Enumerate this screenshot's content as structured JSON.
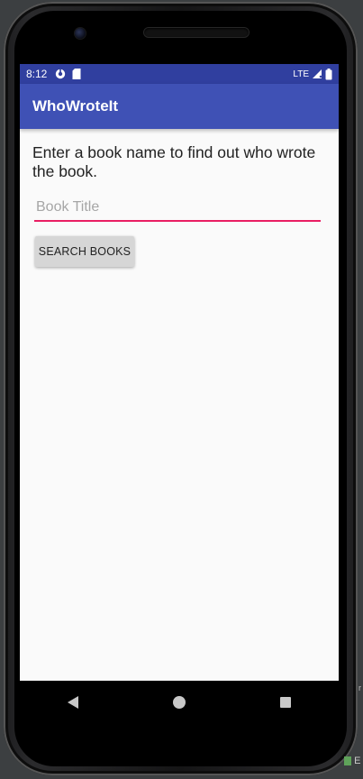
{
  "status_bar": {
    "time": "8:12",
    "network": "LTE",
    "icons": [
      "data-saver-icon",
      "sd-card-icon",
      "signal-icon",
      "battery-icon"
    ]
  },
  "app_bar": {
    "title": "WhoWroteIt"
  },
  "main": {
    "instructions": "Enter a book name to find out who wrote the book.",
    "book_input": {
      "placeholder": "Book Title",
      "value": ""
    },
    "search_button_label": "SEARCH BOOKS"
  },
  "nav_bar": {
    "icons": [
      "back-icon",
      "home-icon",
      "recents-icon"
    ]
  },
  "ide_fragment": {
    "letter": "E",
    "side_text": "r"
  },
  "colors": {
    "status_bar": "#303f9f",
    "app_bar": "#3f51b5",
    "accent": "#e91e63",
    "button": "#d6d6d6"
  }
}
